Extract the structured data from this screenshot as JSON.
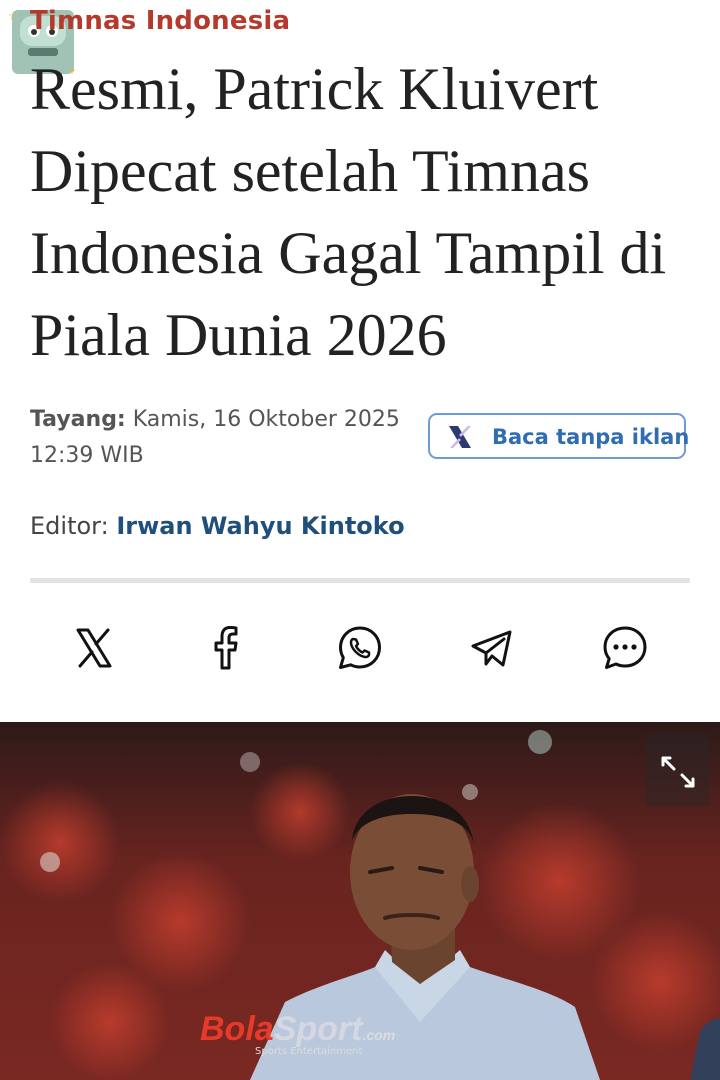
{
  "article": {
    "category": "Timnas Indonesia",
    "headline": "Resmi, Patrick Kluivert Dipecat setelah Timnas Indonesia Gagal Tampil di Piala Dunia 2026",
    "publish_label": "Tayang:",
    "publish_date": "Kamis, 16 Oktober 2025",
    "publish_time": "12:39 WIB",
    "editor_label": "Editor:",
    "editor_name": "Irwan Wahyu Kintoko"
  },
  "ad_free_button": {
    "label": "Baca tanpa iklan",
    "icon": "x-logo-icon",
    "border_color": "#6e9bd4",
    "text_color": "#2f6db0"
  },
  "share": [
    {
      "icon": "x-icon",
      "label": "X"
    },
    {
      "icon": "facebook-icon",
      "label": "Facebook"
    },
    {
      "icon": "whatsapp-icon",
      "label": "WhatsApp"
    },
    {
      "icon": "telegram-icon",
      "label": "Telegram"
    },
    {
      "icon": "chat-icon",
      "label": "More"
    }
  ],
  "photo": {
    "watermark_brand": "Bola",
    "watermark_brand2": "Sport",
    "watermark_suffix": ".com",
    "watermark_sub": "Sports   Entertainment",
    "expand_icon": "expand-icon"
  },
  "colors": {
    "category": "#b43a2c",
    "headline": "#222222",
    "editor_name": "#1f4f7a"
  }
}
